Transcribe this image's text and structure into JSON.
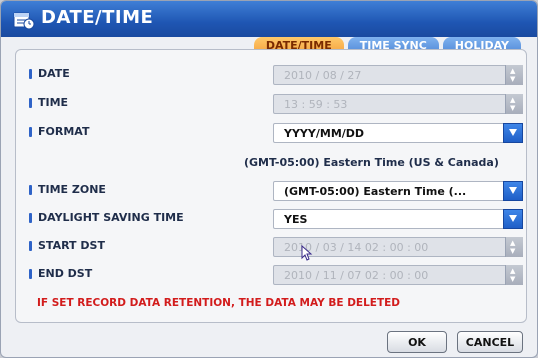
{
  "window": {
    "title": "DATE/TIME",
    "title_icon": "calendar-clock-icon"
  },
  "tabs": [
    {
      "label": "DATE/TIME",
      "active": true
    },
    {
      "label": "TIME SYNC",
      "active": false
    },
    {
      "label": "HOLIDAY",
      "active": false
    }
  ],
  "fields": {
    "date": {
      "label": "DATE",
      "value": "2010 / 08 / 27"
    },
    "time": {
      "label": "TIME",
      "value": "13 : 59 : 53"
    },
    "format": {
      "label": "FORMAT",
      "value": "YYYY/MM/DD"
    },
    "timezone_info": "(GMT-05:00) Eastern Time (US & Canada)",
    "time_zone": {
      "label": "TIME ZONE",
      "value": "(GMT-05:00) Eastern Time (..."
    },
    "dst": {
      "label": "DAYLIGHT SAVING TIME",
      "value": "YES"
    },
    "start_dst": {
      "label": "START DST",
      "value": "2010 / 03 / 14   02 : 00 : 00"
    },
    "end_dst": {
      "label": "END DST",
      "value": "2010 / 11 / 07   02 : 00 : 00"
    }
  },
  "warning": "IF SET RECORD DATA RETENTION,  THE DATA MAY BE DELETED",
  "buttons": {
    "ok": "OK",
    "cancel": "CANCEL"
  },
  "colors": {
    "accent": "#1f56b3",
    "tab_active": "#f4a03b",
    "warning": "#d21c1c"
  }
}
